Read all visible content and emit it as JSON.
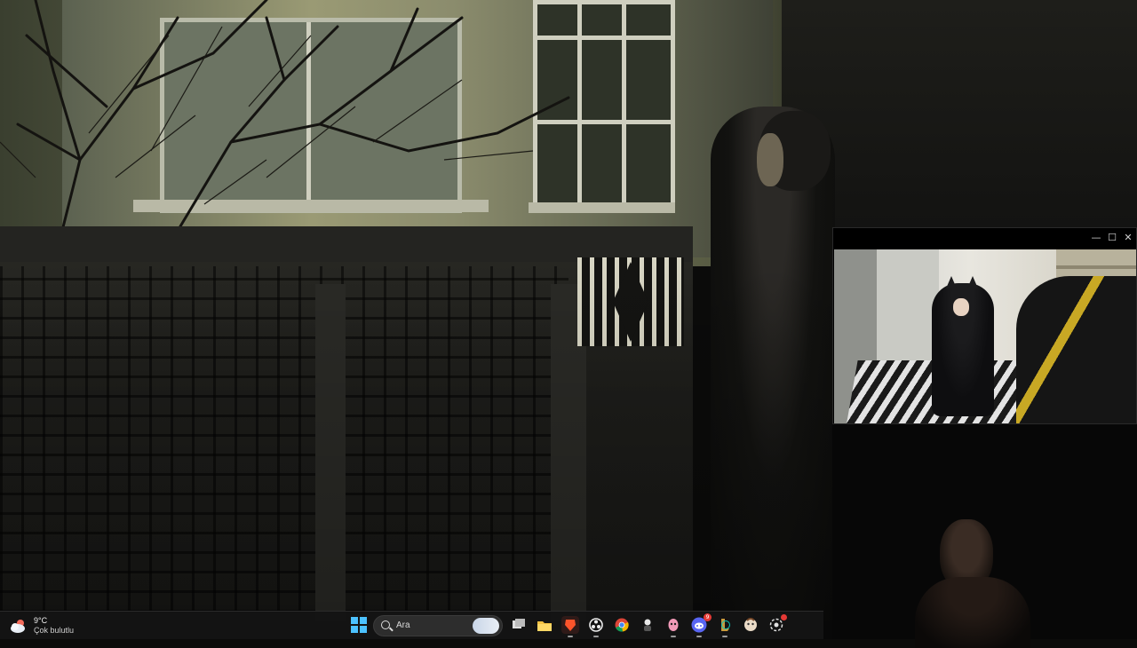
{
  "background": {
    "description_hidden": true
  },
  "webcam_window": {
    "controls": {
      "minimize_glyph": "—",
      "maximize_glyph": "☐",
      "close_glyph": "✕"
    }
  },
  "taskbar": {
    "weather": {
      "temperature": "9°C",
      "condition": "Çok bulutlu",
      "icon": "cloudy-weather-icon"
    },
    "search": {
      "placeholder": "Ara"
    },
    "apps": [
      {
        "name": "task-view-icon"
      },
      {
        "name": "file-explorer-icon"
      },
      {
        "name": "brave-browser-icon"
      },
      {
        "name": "obs-studio-icon"
      },
      {
        "name": "chrome-icon"
      },
      {
        "name": "app-character-icon"
      },
      {
        "name": "app-pink-character-icon"
      },
      {
        "name": "discord-icon",
        "badge": "9"
      },
      {
        "name": "league-client-icon"
      },
      {
        "name": "app-face-icon"
      },
      {
        "name": "app-settings-notification-icon"
      }
    ],
    "accent_color": "#4cc2ff",
    "badge_color": "#e53935"
  }
}
